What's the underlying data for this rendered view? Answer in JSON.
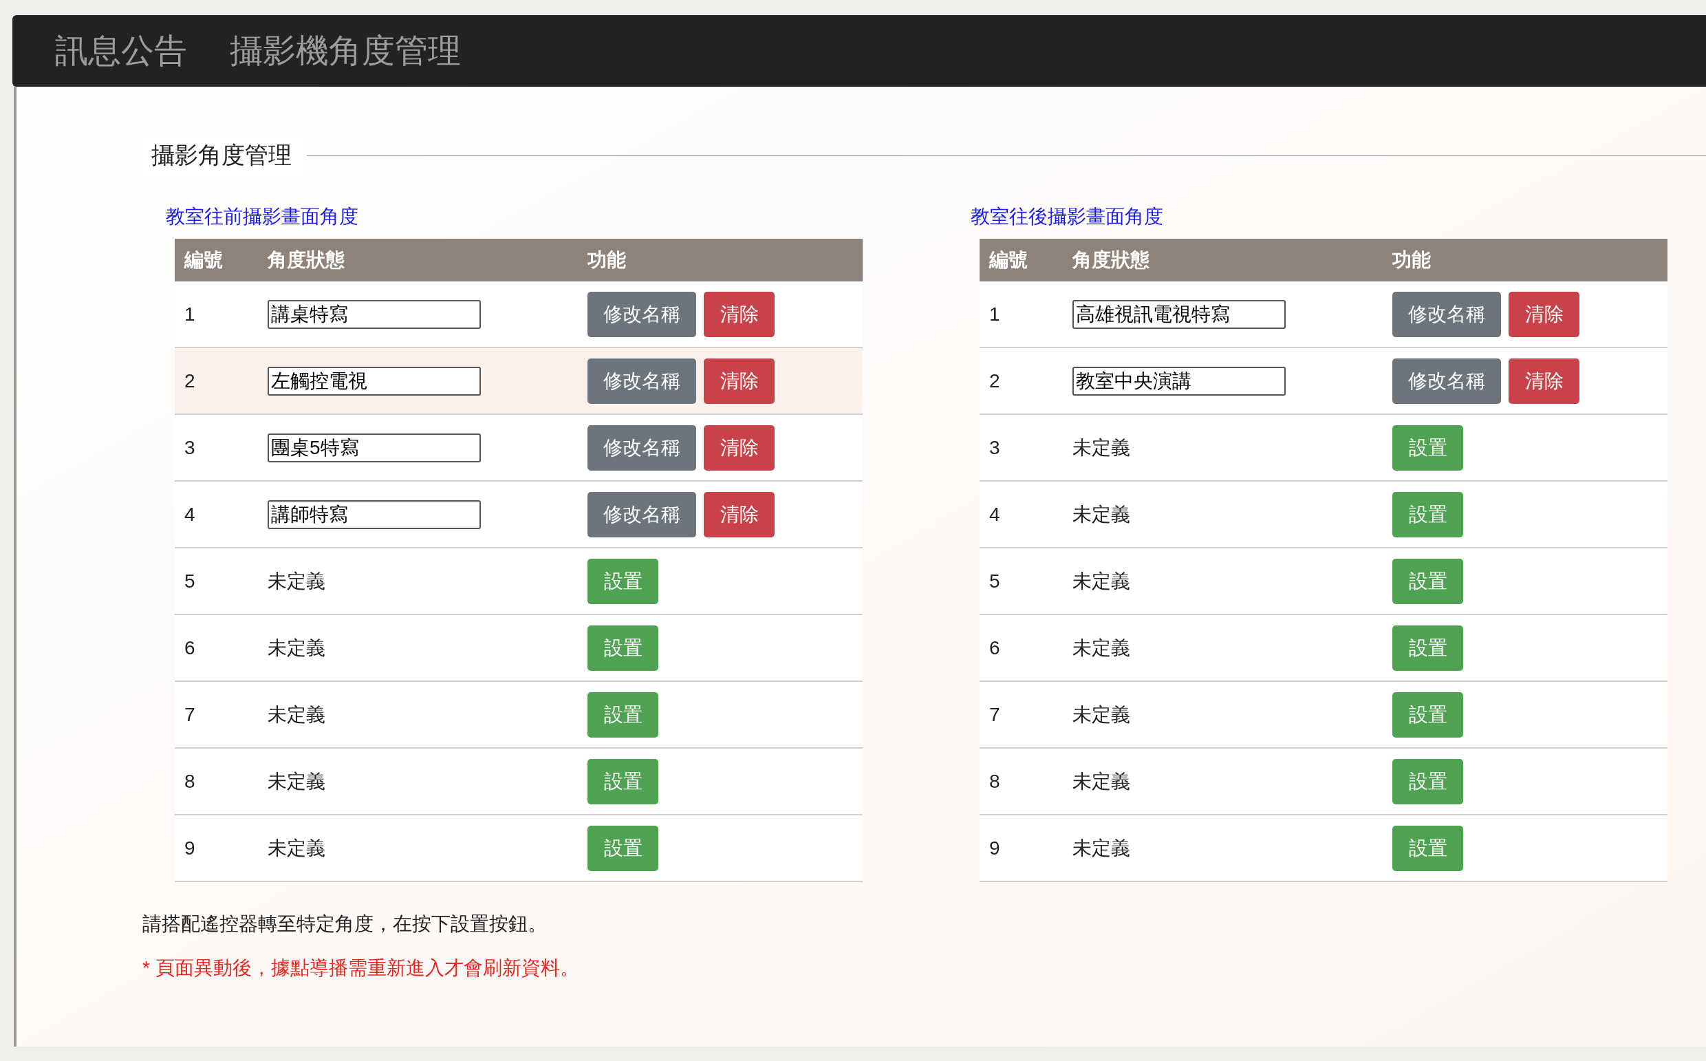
{
  "nav": {
    "items": [
      "訊息公告",
      "攝影機角度管理"
    ]
  },
  "section": {
    "title": "攝影角度管理"
  },
  "tables": [
    {
      "caption": "教室往前攝影畫面角度",
      "columns": [
        "編號",
        "角度狀態",
        "功能"
      ],
      "rows": [
        {
          "number": "1",
          "kind": "named",
          "value": "講桌特寫",
          "highlighted": false,
          "buttons": [
            {
              "label": "修改名稱",
              "kind": "rename"
            },
            {
              "label": "清除",
              "kind": "clear"
            }
          ]
        },
        {
          "number": "2",
          "kind": "named",
          "value": "左觸控電視",
          "highlighted": true,
          "buttons": [
            {
              "label": "修改名稱",
              "kind": "rename"
            },
            {
              "label": "清除",
              "kind": "clear"
            }
          ]
        },
        {
          "number": "3",
          "kind": "named",
          "value": "團桌5特寫",
          "highlighted": false,
          "buttons": [
            {
              "label": "修改名稱",
              "kind": "rename"
            },
            {
              "label": "清除",
              "kind": "clear"
            }
          ]
        },
        {
          "number": "4",
          "kind": "named",
          "value": "講師特寫",
          "highlighted": false,
          "buttons": [
            {
              "label": "修改名稱",
              "kind": "rename"
            },
            {
              "label": "清除",
              "kind": "clear"
            }
          ]
        },
        {
          "number": "5",
          "kind": "empty",
          "status": "未定義",
          "highlighted": false,
          "buttons": [
            {
              "label": "設置",
              "kind": "set"
            }
          ]
        },
        {
          "number": "6",
          "kind": "empty",
          "status": "未定義",
          "highlighted": false,
          "buttons": [
            {
              "label": "設置",
              "kind": "set"
            }
          ]
        },
        {
          "number": "7",
          "kind": "empty",
          "status": "未定義",
          "highlighted": false,
          "buttons": [
            {
              "label": "設置",
              "kind": "set"
            }
          ]
        },
        {
          "number": "8",
          "kind": "empty",
          "status": "未定義",
          "highlighted": false,
          "buttons": [
            {
              "label": "設置",
              "kind": "set"
            }
          ]
        },
        {
          "number": "9",
          "kind": "empty",
          "status": "未定義",
          "highlighted": false,
          "buttons": [
            {
              "label": "設置",
              "kind": "set"
            }
          ]
        }
      ]
    },
    {
      "caption": "教室往後攝影畫面角度",
      "columns": [
        "編號",
        "角度狀態",
        "功能"
      ],
      "rows": [
        {
          "number": "1",
          "kind": "named",
          "value": "高雄視訊電視特寫",
          "highlighted": false,
          "buttons": [
            {
              "label": "修改名稱",
              "kind": "rename"
            },
            {
              "label": "清除",
              "kind": "clear"
            }
          ]
        },
        {
          "number": "2",
          "kind": "named",
          "value": "教室中央演講",
          "highlighted": false,
          "buttons": [
            {
              "label": "修改名稱",
              "kind": "rename"
            },
            {
              "label": "清除",
              "kind": "clear"
            }
          ]
        },
        {
          "number": "3",
          "kind": "empty",
          "status": "未定義",
          "highlighted": false,
          "buttons": [
            {
              "label": "設置",
              "kind": "set"
            }
          ]
        },
        {
          "number": "4",
          "kind": "empty",
          "status": "未定義",
          "highlighted": false,
          "buttons": [
            {
              "label": "設置",
              "kind": "set"
            }
          ]
        },
        {
          "number": "5",
          "kind": "empty",
          "status": "未定義",
          "highlighted": false,
          "buttons": [
            {
              "label": "設置",
              "kind": "set"
            }
          ]
        },
        {
          "number": "6",
          "kind": "empty",
          "status": "未定義",
          "highlighted": false,
          "buttons": [
            {
              "label": "設置",
              "kind": "set"
            }
          ]
        },
        {
          "number": "7",
          "kind": "empty",
          "status": "未定義",
          "highlighted": false,
          "buttons": [
            {
              "label": "設置",
              "kind": "set"
            }
          ]
        },
        {
          "number": "8",
          "kind": "empty",
          "status": "未定義",
          "highlighted": false,
          "buttons": [
            {
              "label": "設置",
              "kind": "set"
            }
          ]
        },
        {
          "number": "9",
          "kind": "empty",
          "status": "未定義",
          "highlighted": false,
          "buttons": [
            {
              "label": "設置",
              "kind": "set"
            }
          ]
        }
      ]
    }
  ],
  "notes": [
    {
      "text": "請搭配遙控器轉至特定角度，在按下設置按鈕。",
      "kind": "info"
    },
    {
      "text": "* 頁面異動後，據點導播需重新進入才會刷新資料。",
      "kind": "warning"
    }
  ]
}
